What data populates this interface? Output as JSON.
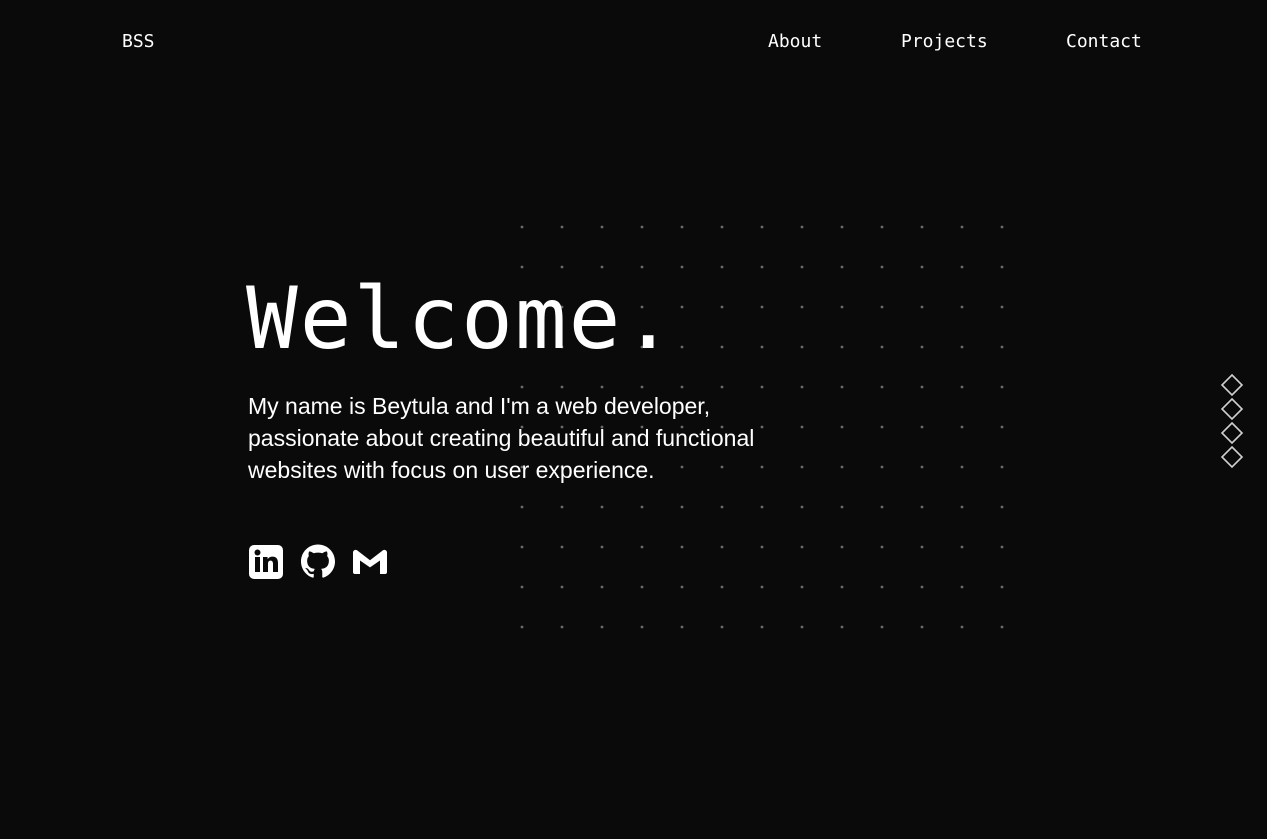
{
  "nav": {
    "logo": "BSS",
    "links": [
      {
        "label": "About"
      },
      {
        "label": "Projects"
      },
      {
        "label": "Contact"
      }
    ]
  },
  "hero": {
    "title": "Welcome.",
    "description": "My name is Beytula and I'm a web developer, passionate about creating beautiful and functional websites with focus on user experience."
  },
  "socials": [
    {
      "icon": "linkedin-icon"
    },
    {
      "icon": "github-icon"
    },
    {
      "icon": "gmail-icon"
    }
  ],
  "section_indicators": {
    "count": 4,
    "icon": "diamond-icon"
  },
  "colors": {
    "background": "#0a0a0a",
    "text": "#ffffff",
    "dots": "#6b6b6b",
    "indicator_stroke": "#d0d0d0"
  }
}
